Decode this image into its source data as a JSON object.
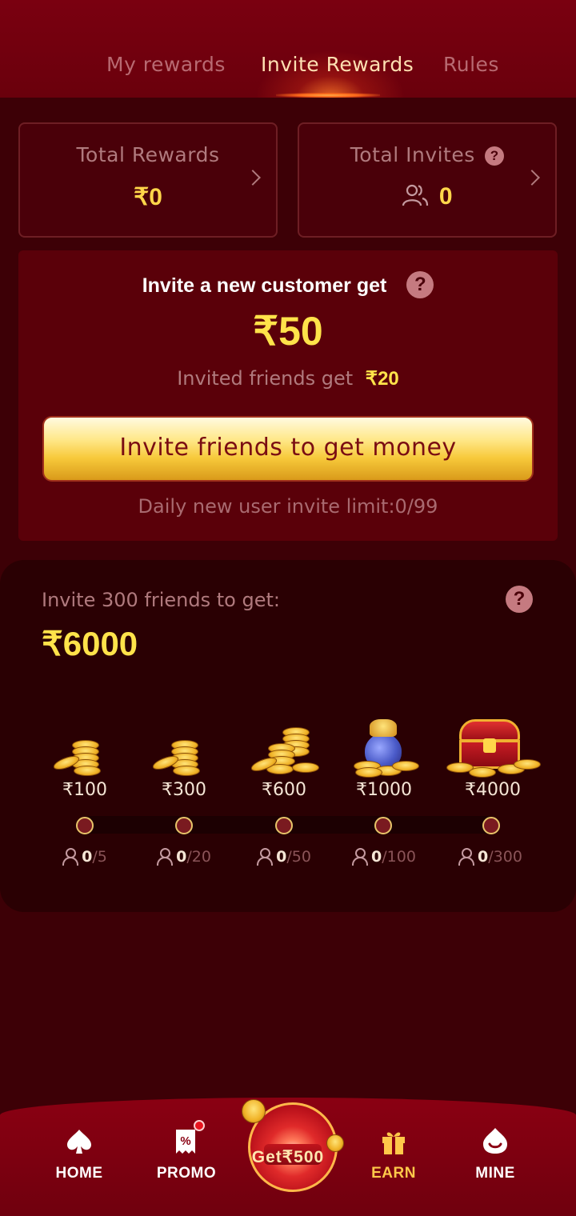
{
  "tabs": [
    {
      "label": "My rewards",
      "active": false
    },
    {
      "label": "Invite Rewards",
      "active": true
    },
    {
      "label": "Rules",
      "active": false
    }
  ],
  "summary": {
    "total_rewards_label": "Total Rewards",
    "total_rewards_value": "₹0",
    "total_invites_label": "Total Invites",
    "total_invites_value": "0",
    "help_glyph": "?"
  },
  "invite": {
    "title": "Invite a new customer get",
    "amount": "₹50",
    "friend_label": "Invited friends get",
    "friend_amount": "₹20",
    "button_label": "Invite friends to get money",
    "limit_text": "Daily new user invite limit:0/99"
  },
  "milestones": {
    "title": "Invite 300 friends to get:",
    "total": "₹6000",
    "items": [
      {
        "reward": "₹100",
        "current": "0",
        "target": "/5",
        "icon": "coin-stack-icon"
      },
      {
        "reward": "₹300",
        "current": "0",
        "target": "/20",
        "icon": "coin-stack-icon"
      },
      {
        "reward": "₹600",
        "current": "0",
        "target": "/50",
        "icon": "coin-pile-icon"
      },
      {
        "reward": "₹1000",
        "current": "0",
        "target": "/100",
        "icon": "money-bag-icon"
      },
      {
        "reward": "₹4000",
        "current": "0",
        "target": "/300",
        "icon": "treasure-chest-icon"
      }
    ],
    "progress": 0
  },
  "nav": {
    "home": "HOME",
    "promo": "PROMO",
    "wheel": "Get₹500",
    "earn": "EARN",
    "mine": "MINE"
  },
  "colors": {
    "background": "#3d0006",
    "header": "#7a0010",
    "gold": "#ffe34a",
    "button_text": "#7a0d12",
    "muted": "#b07a7e"
  }
}
